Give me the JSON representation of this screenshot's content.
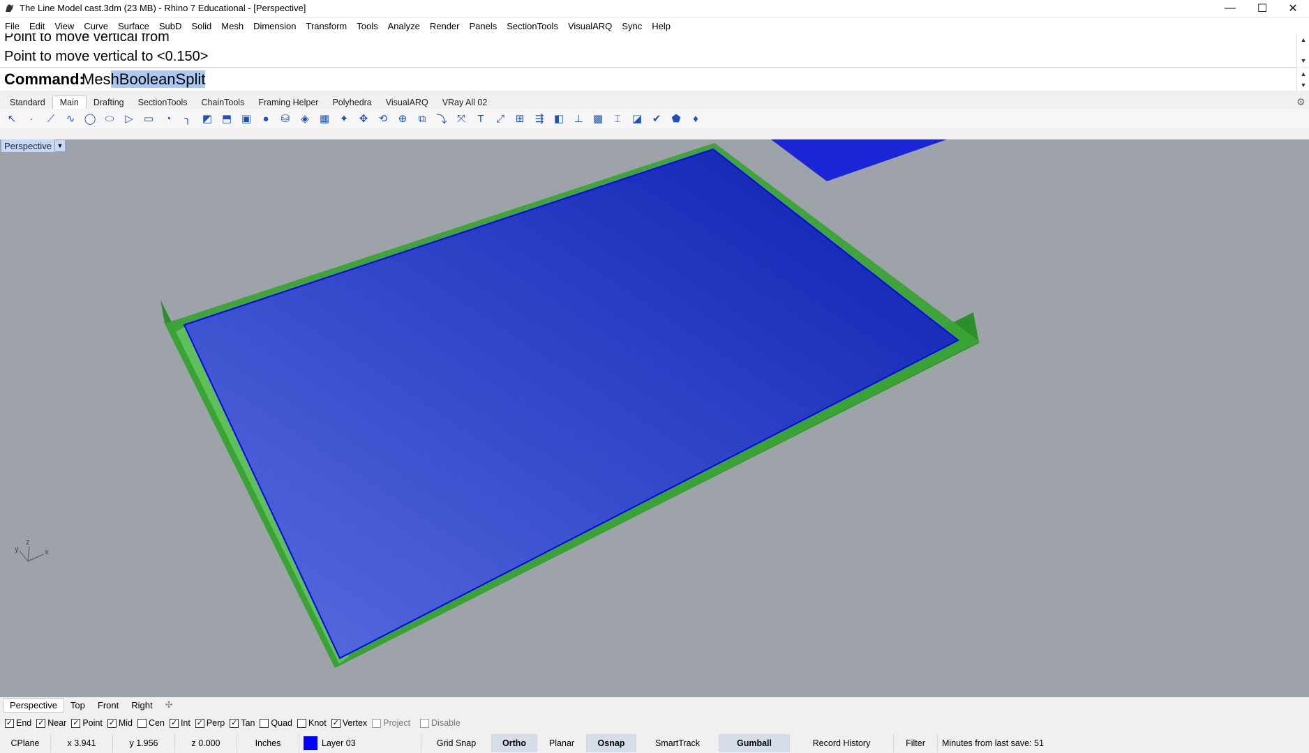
{
  "titlebar": {
    "title": "The Line Model cast.3dm (23 MB) - Rhino 7 Educational - [Perspective]",
    "minimize": "—",
    "maximize": "☐",
    "close": "✕"
  },
  "menu": [
    "File",
    "Edit",
    "View",
    "Curve",
    "Surface",
    "SubD",
    "Solid",
    "Mesh",
    "Dimension",
    "Transform",
    "Tools",
    "Analyze",
    "Render",
    "Panels",
    "SectionTools",
    "VisualARQ",
    "Sync",
    "Help"
  ],
  "history": {
    "line1": "Point to move vertical from",
    "line2": "Point to move vertical to <0.150>"
  },
  "command": {
    "label": "Command:",
    "value_plain": "Mes",
    "value_selected": "hBooleanSplit"
  },
  "toolbar_tabs": [
    "Standard",
    "Main",
    "Drafting",
    "SectionTools",
    "ChainTools",
    "Framing Helper",
    "Polyhedra",
    "VisualARQ",
    "VRay All 02"
  ],
  "toolbar_active": "Main",
  "tools": [
    "select-arrow-icon",
    "point-icon",
    "polyline-icon",
    "curve-icon",
    "circle-icon",
    "ellipse-icon",
    "polygon-icon",
    "rectangle-icon",
    "arc-icon",
    "fillet-icon",
    "surface-icon",
    "extrude-icon",
    "box-icon",
    "sphere-icon",
    "cylinder-icon",
    "loft-icon",
    "mesh-icon",
    "revolve-icon",
    "move-icon",
    "rotate-icon",
    "boolean-icon",
    "group-icon",
    "curve-tool-icon",
    "gumball-icon",
    "text-icon",
    "scale-icon",
    "array-icon",
    "orient-icon",
    "view-icon",
    "dimension-icon",
    "grid-icon",
    "layout-icon",
    "section-icon",
    "check-icon",
    "shade-icon",
    "render-icon"
  ],
  "viewport": {
    "label": "Perspective",
    "axis_x": "x",
    "axis_y": "y",
    "axis_z": "z"
  },
  "viewport_tabs": [
    "Perspective",
    "Top",
    "Front",
    "Right"
  ],
  "viewport_tabs_active": "Perspective",
  "osnaps": [
    {
      "label": "End",
      "checked": true
    },
    {
      "label": "Near",
      "checked": true
    },
    {
      "label": "Point",
      "checked": true
    },
    {
      "label": "Mid",
      "checked": true
    },
    {
      "label": "Cen",
      "checked": false
    },
    {
      "label": "Int",
      "checked": true
    },
    {
      "label": "Perp",
      "checked": true
    },
    {
      "label": "Tan",
      "checked": true
    },
    {
      "label": "Quad",
      "checked": false
    },
    {
      "label": "Knot",
      "checked": false
    },
    {
      "label": "Vertex",
      "checked": true
    },
    {
      "label": "Project",
      "checked": false,
      "disabled": true
    },
    {
      "label": "Disable",
      "checked": false,
      "disabled": true
    }
  ],
  "status": {
    "cplane": "CPlane",
    "x": "x 3.941",
    "y": "y 1.956",
    "z": "z 0.000",
    "units": "Inches",
    "layer": "Layer 03",
    "layer_color": "#0000ff",
    "grid_snap": "Grid Snap",
    "ortho": "Ortho",
    "planar": "Planar",
    "osnap": "Osnap",
    "smarttrack": "SmartTrack",
    "gumball": "Gumball",
    "record_history": "Record History",
    "filter": "Filter",
    "minutes": "Minutes from last save: 51"
  },
  "colors": {
    "viewport_bg": "#9ea3aa",
    "slab_green": "#2f9a2c",
    "slab_blue": "#1b2fd6"
  }
}
